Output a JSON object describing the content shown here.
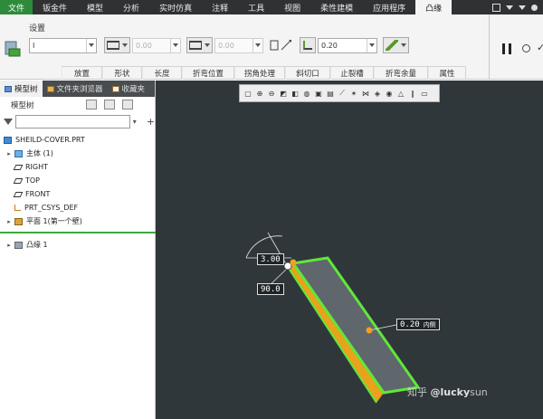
{
  "menubar": {
    "items": [
      "文件",
      "钣金件",
      "模型",
      "分析",
      "实时仿真",
      "注释",
      "工具",
      "视图",
      "柔性建模",
      "应用程序",
      "凸缘"
    ],
    "active_index": 10,
    "file_color": "#2e8b3c"
  },
  "ribbon": {
    "settings_label": "设置",
    "shape_value": "I",
    "length1": "0.00",
    "length2": "0.00",
    "thickness": "0.20",
    "groups": [
      "放置",
      "形状",
      "长度",
      "折弯位置",
      "拐角处理",
      "斜切口",
      "止裂槽",
      "折弯余量",
      "属性"
    ]
  },
  "left_panel": {
    "tabs": [
      "模型树",
      "文件夹浏览器",
      "收藏夹"
    ],
    "tree_title": "模型树",
    "items": [
      {
        "label": "SHEILD-COVER.PRT",
        "icon": "part-icon"
      },
      {
        "label": "主体 (1)",
        "icon": "body-icon"
      },
      {
        "label": "RIGHT",
        "icon": "datum-plane-icon"
      },
      {
        "label": "TOP",
        "icon": "datum-plane-icon"
      },
      {
        "label": "FRONT",
        "icon": "datum-plane-icon"
      },
      {
        "label": "PRT_CSYS_DEF",
        "icon": "csys-icon"
      },
      {
        "label": "平面 1(第一个壁)",
        "icon": "planar-wall-icon"
      },
      {
        "label": "凸缘 1",
        "icon": "flange-icon"
      }
    ]
  },
  "graphics": {
    "dim_radius": "3.00",
    "dim_angle": "90.0",
    "dim_thickness": "0.20",
    "dim_thickness_suffix": "内侧",
    "part_face_color": "#5f666c",
    "edge_color": "#5fe83a",
    "wall_side_color": "#e8a21c"
  },
  "watermark": {
    "prefix": "知乎 ",
    "handle": "@lucky",
    "suffix": "sun"
  }
}
